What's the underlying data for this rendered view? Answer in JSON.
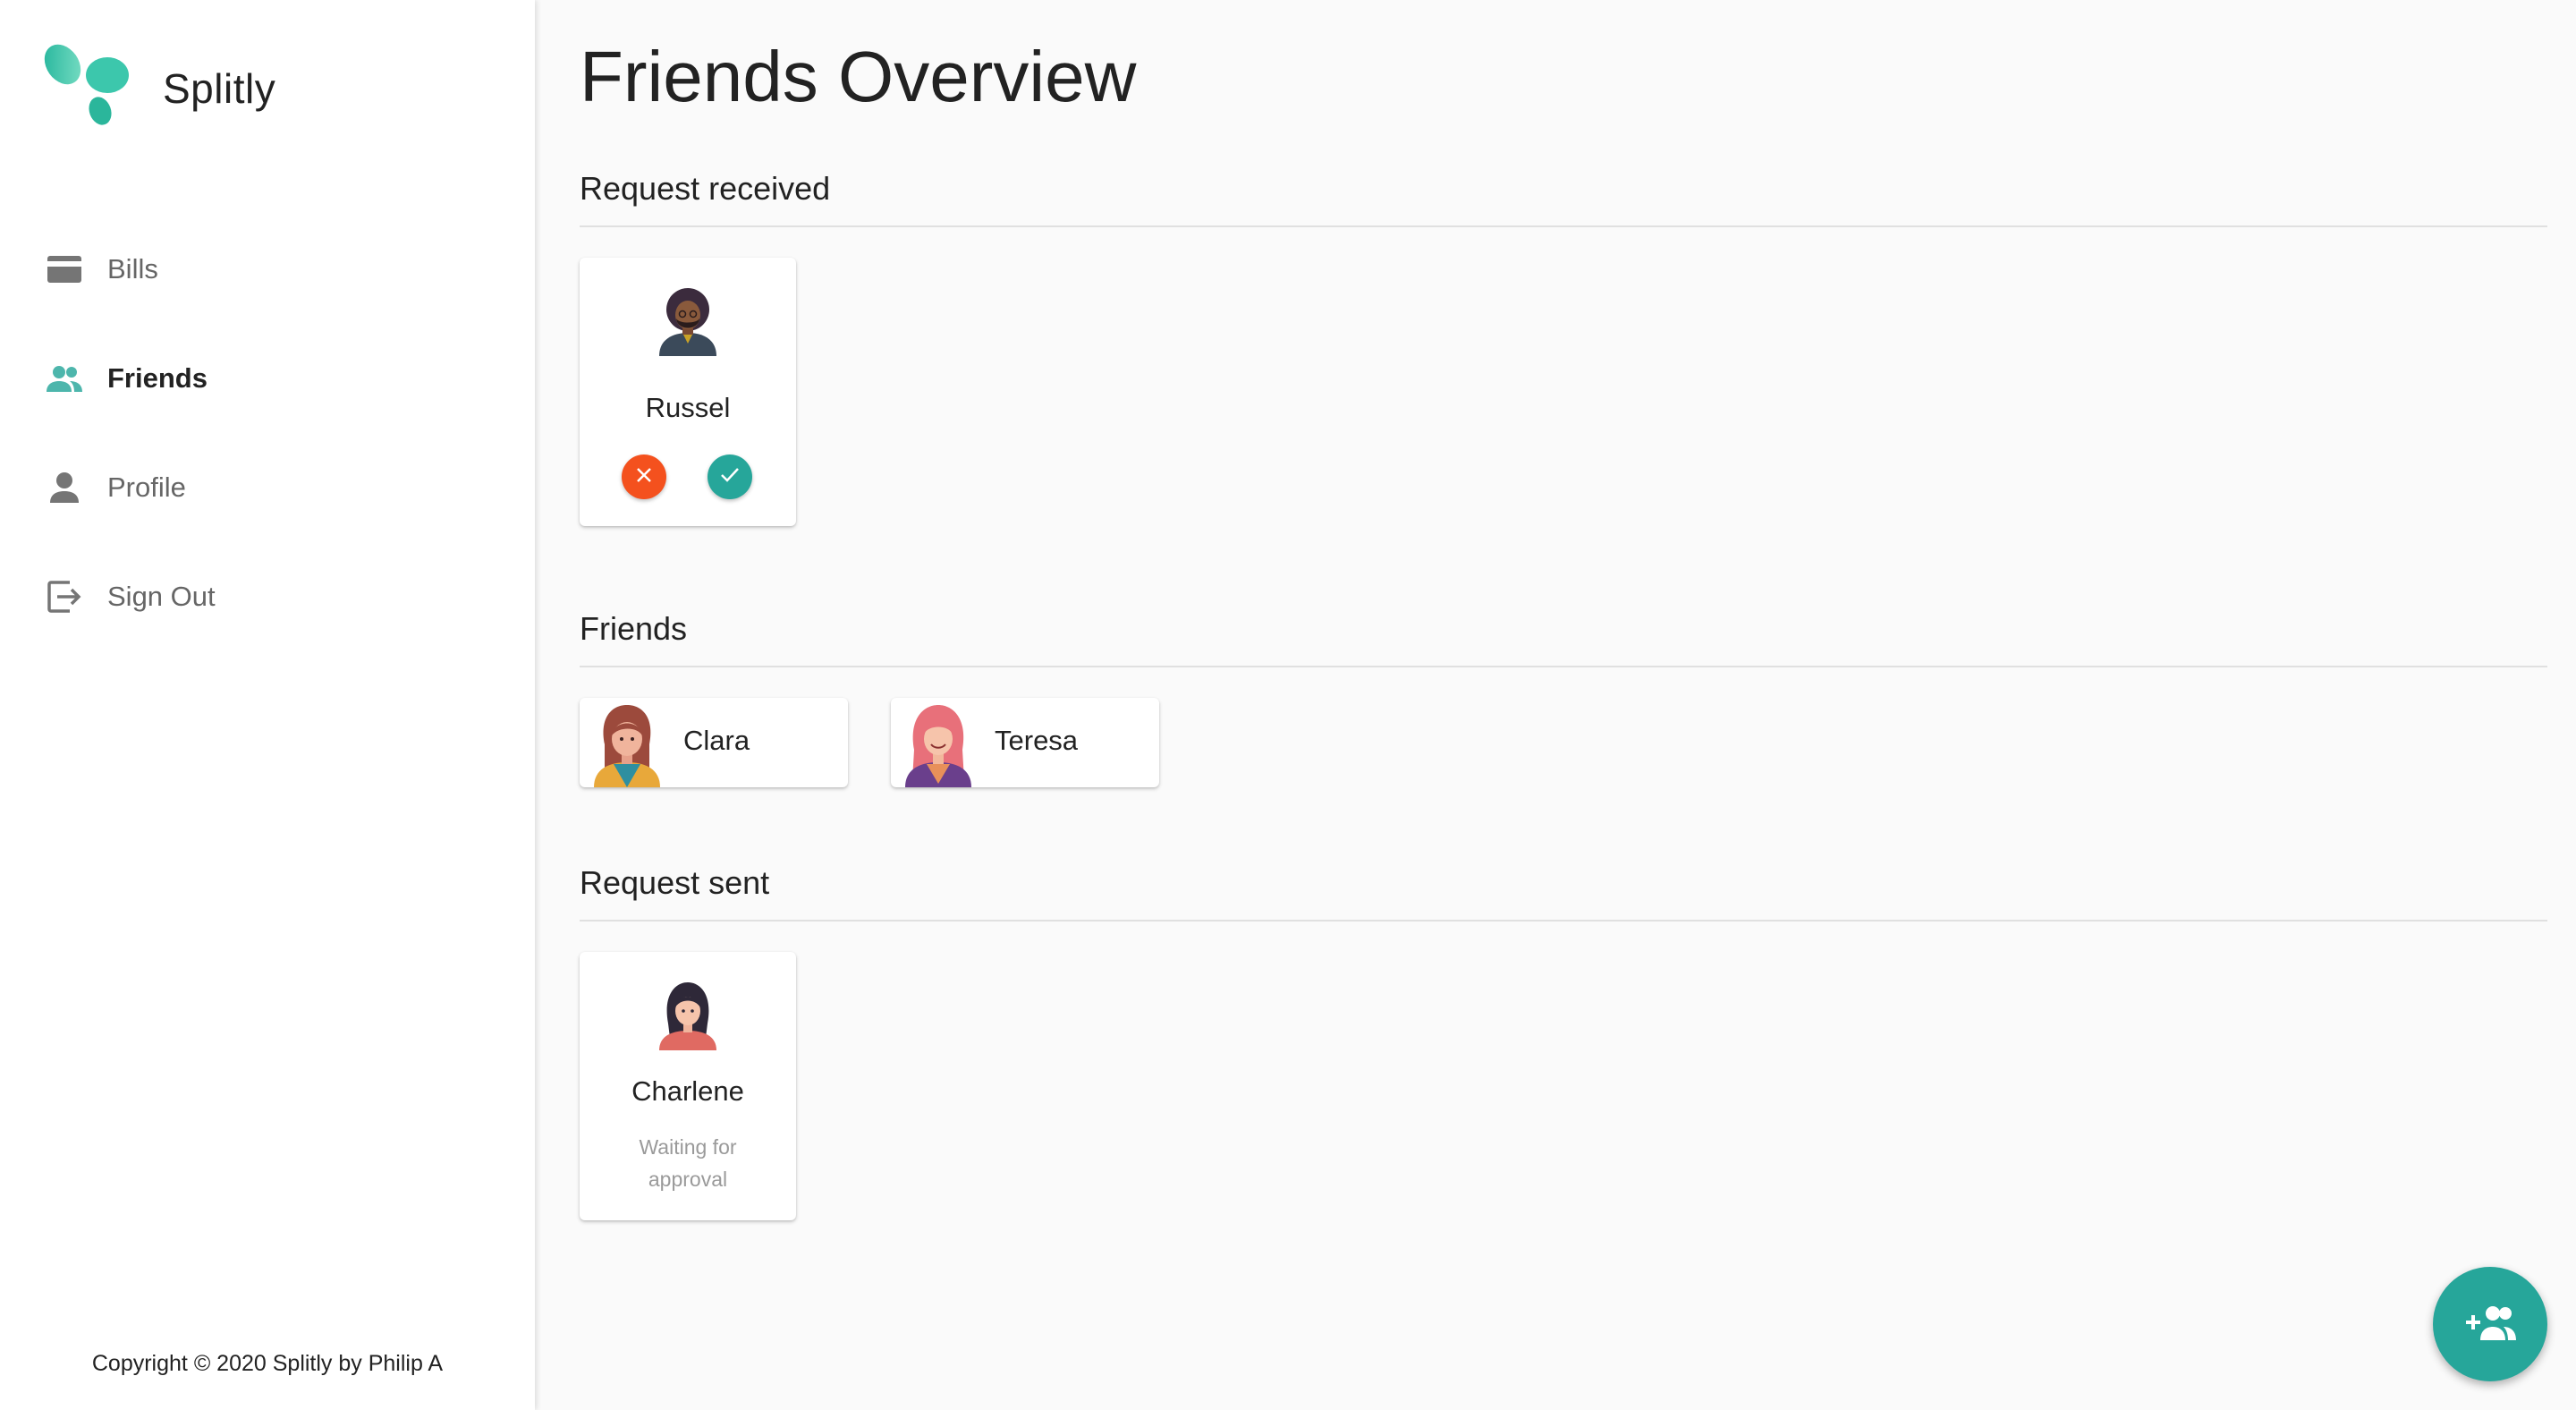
{
  "app": {
    "name": "Splitly"
  },
  "sidebar": {
    "items": [
      {
        "label": "Bills",
        "icon": "credit-card-icon",
        "active": false
      },
      {
        "label": "Friends",
        "icon": "people-icon",
        "active": true
      },
      {
        "label": "Profile",
        "icon": "person-icon",
        "active": false
      },
      {
        "label": "Sign Out",
        "icon": "exit-icon",
        "active": false
      }
    ],
    "copyright": "Copyright © 2020 Splitly by Philip A"
  },
  "main": {
    "title": "Friends Overview",
    "sections": {
      "received": {
        "title": "Request received",
        "items": [
          {
            "name": "Russel"
          }
        ]
      },
      "friends": {
        "title": "Friends",
        "items": [
          {
            "name": "Clara"
          },
          {
            "name": "Teresa"
          }
        ]
      },
      "sent": {
        "title": "Request sent",
        "items": [
          {
            "name": "Charlene",
            "status": "Waiting for approval"
          }
        ]
      }
    }
  },
  "fab": {
    "icon": "add-friend-icon"
  },
  "colors": {
    "accent": "#26a69a",
    "reject": "#f4511e",
    "accept": "#26a69a",
    "active_nav_icon": "#4db6ac",
    "inactive_nav_icon": "#757575"
  }
}
